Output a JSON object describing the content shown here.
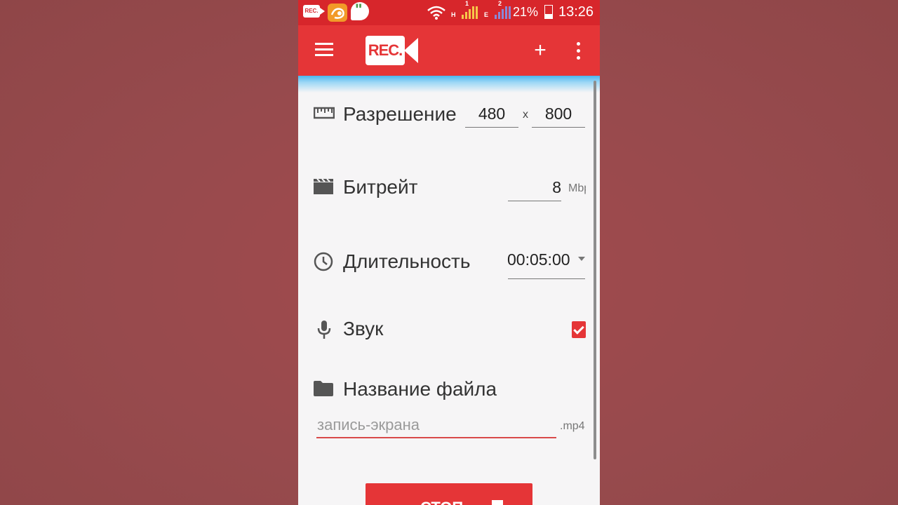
{
  "status_bar": {
    "network_h": "H",
    "network_e": "E",
    "sim1": "1",
    "sim2": "2",
    "battery": "21%",
    "time": "13:26",
    "rec_badge": "REC."
  },
  "toolbar": {
    "logo_text": "REC.",
    "add_label": "+"
  },
  "settings": {
    "resolution": {
      "label": "Разрешение",
      "width": "480",
      "separator": "x",
      "height": "800"
    },
    "bitrate": {
      "label": "Битрейт",
      "value": "8",
      "unit": "Mbp"
    },
    "duration": {
      "label": "Длительность",
      "value": "00:05:00"
    },
    "sound": {
      "label": "Звук",
      "checked": true
    },
    "filename": {
      "label": "Название файла",
      "placeholder": "запись-экрана",
      "extension": ".mp4"
    }
  },
  "actions": {
    "stop_label": "СТОП"
  },
  "colors": {
    "accent": "#e53537",
    "status_bar": "#d7262b",
    "background": "#f6f5f6"
  },
  "icons": [
    "ruler-icon",
    "clapperboard-icon",
    "clock-icon",
    "microphone-icon",
    "folder-icon",
    "menu-icon",
    "add-icon",
    "more-vert-icon"
  ]
}
